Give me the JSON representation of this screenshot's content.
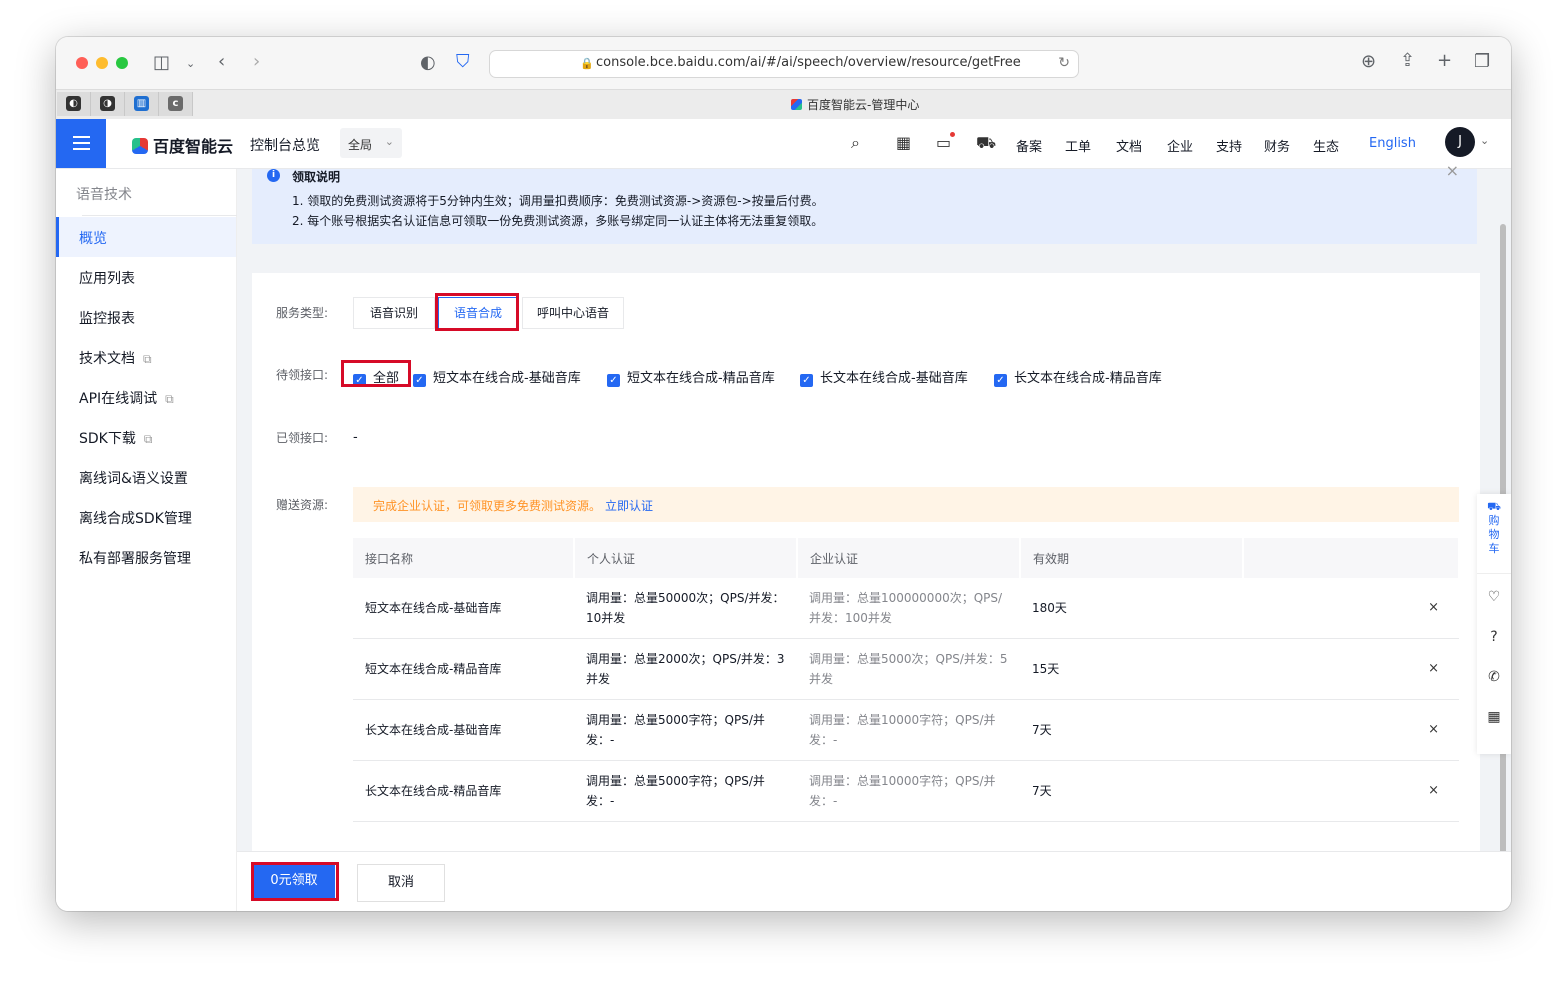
{
  "browser": {
    "url": "console.bce.baidu.com/ai/#/ai/speech/overview/resource/getFree",
    "tab_title": "百度智能云-管理中心"
  },
  "header": {
    "logo": "百度智能云",
    "console_overview": "控制台总览",
    "scope": "全局",
    "nav": [
      "备案",
      "工单",
      "文档",
      "企业",
      "支持",
      "财务",
      "生态"
    ],
    "language": "English",
    "avatar": "J"
  },
  "sidebar": {
    "title": "语音技术",
    "items": [
      "概览",
      "应用列表",
      "监控报表",
      "技术文档",
      "API在线调试",
      "SDK下载",
      "离线词&语义设置",
      "离线合成SDK管理",
      "私有部署服务管理"
    ],
    "active": "概览"
  },
  "notice": {
    "title": "领取说明",
    "line1": "1. 领取的免费测试资源将于5分钟内生效；调用量扣费顺序：免费测试资源->资源包->按量后付费。",
    "line2": "2. 每个账号根据实名认证信息可领取一份免费测试资源，多账号绑定同一认证主体将无法重复领取。"
  },
  "form": {
    "service_type_label": "服务类型:",
    "service_types": [
      "语音识别",
      "语音合成",
      "呼叫中心语音"
    ],
    "selected_service": "语音合成",
    "pending_label": "待领接口:",
    "checkboxes": [
      "全部",
      "短文本在线合成-基础音库",
      "短文本在线合成-精品音库",
      "长文本在线合成-基础音库",
      "长文本在线合成-精品音库"
    ],
    "claimed_label": "已领接口:",
    "claimed_value": "-",
    "gift_label": "赠送资源:",
    "warn_text": "完成企业认证，可领取更多免费测试资源。",
    "warn_link": "立即认证"
  },
  "table": {
    "headers": [
      "接口名称",
      "个人认证",
      "企业认证",
      "有效期"
    ],
    "rows": [
      {
        "name": "短文本在线合成-基础音库",
        "personal": "调用量：总量50000次；QPS/并发：10并发",
        "enterprise": "调用量：总量100000000次；QPS/并发：100并发",
        "validity": "180天",
        "remove": "×"
      },
      {
        "name": "短文本在线合成-精品音库",
        "personal": "调用量：总量2000次；QPS/并发：3并发",
        "enterprise": "调用量：总量5000次；QPS/并发：5并发",
        "validity": "15天",
        "remove": "×"
      },
      {
        "name": "长文本在线合成-基础音库",
        "personal": "调用量：总量5000字符；QPS/并发：-",
        "enterprise": "调用量：总量10000字符；QPS/并发：-",
        "validity": "7天",
        "remove": "×"
      },
      {
        "name": "长文本在线合成-精品音库",
        "personal": "调用量：总量5000字符；QPS/并发：-",
        "enterprise": "调用量：总量10000字符；QPS/并发：-",
        "validity": "7天",
        "remove": "×"
      }
    ]
  },
  "footer": {
    "claim_button": "0元领取",
    "cancel_button": "取消"
  },
  "floatbar": {
    "cart_label": "购物车"
  },
  "colors": {
    "accent": "#2468f2",
    "highlight": "#d60a27",
    "warn_text": "#ff9326",
    "notice_bg": "#e5edfd"
  }
}
